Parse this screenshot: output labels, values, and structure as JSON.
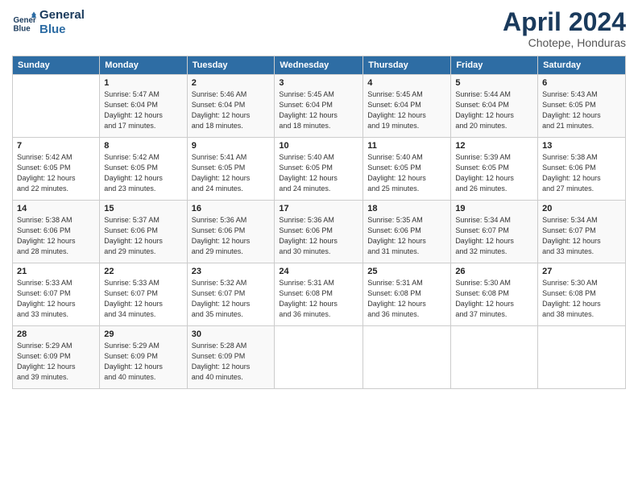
{
  "logo": {
    "line1": "General",
    "line2": "Blue"
  },
  "title": "April 2024",
  "subtitle": "Chotepe, Honduras",
  "days_of_week": [
    "Sunday",
    "Monday",
    "Tuesday",
    "Wednesday",
    "Thursday",
    "Friday",
    "Saturday"
  ],
  "weeks": [
    [
      {
        "day": "",
        "info": ""
      },
      {
        "day": "1",
        "info": "Sunrise: 5:47 AM\nSunset: 6:04 PM\nDaylight: 12 hours\nand 17 minutes."
      },
      {
        "day": "2",
        "info": "Sunrise: 5:46 AM\nSunset: 6:04 PM\nDaylight: 12 hours\nand 18 minutes."
      },
      {
        "day": "3",
        "info": "Sunrise: 5:45 AM\nSunset: 6:04 PM\nDaylight: 12 hours\nand 18 minutes."
      },
      {
        "day": "4",
        "info": "Sunrise: 5:45 AM\nSunset: 6:04 PM\nDaylight: 12 hours\nand 19 minutes."
      },
      {
        "day": "5",
        "info": "Sunrise: 5:44 AM\nSunset: 6:04 PM\nDaylight: 12 hours\nand 20 minutes."
      },
      {
        "day": "6",
        "info": "Sunrise: 5:43 AM\nSunset: 6:05 PM\nDaylight: 12 hours\nand 21 minutes."
      }
    ],
    [
      {
        "day": "7",
        "info": "Sunrise: 5:42 AM\nSunset: 6:05 PM\nDaylight: 12 hours\nand 22 minutes."
      },
      {
        "day": "8",
        "info": "Sunrise: 5:42 AM\nSunset: 6:05 PM\nDaylight: 12 hours\nand 23 minutes."
      },
      {
        "day": "9",
        "info": "Sunrise: 5:41 AM\nSunset: 6:05 PM\nDaylight: 12 hours\nand 24 minutes."
      },
      {
        "day": "10",
        "info": "Sunrise: 5:40 AM\nSunset: 6:05 PM\nDaylight: 12 hours\nand 24 minutes."
      },
      {
        "day": "11",
        "info": "Sunrise: 5:40 AM\nSunset: 6:05 PM\nDaylight: 12 hours\nand 25 minutes."
      },
      {
        "day": "12",
        "info": "Sunrise: 5:39 AM\nSunset: 6:05 PM\nDaylight: 12 hours\nand 26 minutes."
      },
      {
        "day": "13",
        "info": "Sunrise: 5:38 AM\nSunset: 6:06 PM\nDaylight: 12 hours\nand 27 minutes."
      }
    ],
    [
      {
        "day": "14",
        "info": "Sunrise: 5:38 AM\nSunset: 6:06 PM\nDaylight: 12 hours\nand 28 minutes."
      },
      {
        "day": "15",
        "info": "Sunrise: 5:37 AM\nSunset: 6:06 PM\nDaylight: 12 hours\nand 29 minutes."
      },
      {
        "day": "16",
        "info": "Sunrise: 5:36 AM\nSunset: 6:06 PM\nDaylight: 12 hours\nand 29 minutes."
      },
      {
        "day": "17",
        "info": "Sunrise: 5:36 AM\nSunset: 6:06 PM\nDaylight: 12 hours\nand 30 minutes."
      },
      {
        "day": "18",
        "info": "Sunrise: 5:35 AM\nSunset: 6:06 PM\nDaylight: 12 hours\nand 31 minutes."
      },
      {
        "day": "19",
        "info": "Sunrise: 5:34 AM\nSunset: 6:07 PM\nDaylight: 12 hours\nand 32 minutes."
      },
      {
        "day": "20",
        "info": "Sunrise: 5:34 AM\nSunset: 6:07 PM\nDaylight: 12 hours\nand 33 minutes."
      }
    ],
    [
      {
        "day": "21",
        "info": "Sunrise: 5:33 AM\nSunset: 6:07 PM\nDaylight: 12 hours\nand 33 minutes."
      },
      {
        "day": "22",
        "info": "Sunrise: 5:33 AM\nSunset: 6:07 PM\nDaylight: 12 hours\nand 34 minutes."
      },
      {
        "day": "23",
        "info": "Sunrise: 5:32 AM\nSunset: 6:07 PM\nDaylight: 12 hours\nand 35 minutes."
      },
      {
        "day": "24",
        "info": "Sunrise: 5:31 AM\nSunset: 6:08 PM\nDaylight: 12 hours\nand 36 minutes."
      },
      {
        "day": "25",
        "info": "Sunrise: 5:31 AM\nSunset: 6:08 PM\nDaylight: 12 hours\nand 36 minutes."
      },
      {
        "day": "26",
        "info": "Sunrise: 5:30 AM\nSunset: 6:08 PM\nDaylight: 12 hours\nand 37 minutes."
      },
      {
        "day": "27",
        "info": "Sunrise: 5:30 AM\nSunset: 6:08 PM\nDaylight: 12 hours\nand 38 minutes."
      }
    ],
    [
      {
        "day": "28",
        "info": "Sunrise: 5:29 AM\nSunset: 6:09 PM\nDaylight: 12 hours\nand 39 minutes."
      },
      {
        "day": "29",
        "info": "Sunrise: 5:29 AM\nSunset: 6:09 PM\nDaylight: 12 hours\nand 40 minutes."
      },
      {
        "day": "30",
        "info": "Sunrise: 5:28 AM\nSunset: 6:09 PM\nDaylight: 12 hours\nand 40 minutes."
      },
      {
        "day": "",
        "info": ""
      },
      {
        "day": "",
        "info": ""
      },
      {
        "day": "",
        "info": ""
      },
      {
        "day": "",
        "info": ""
      }
    ]
  ]
}
